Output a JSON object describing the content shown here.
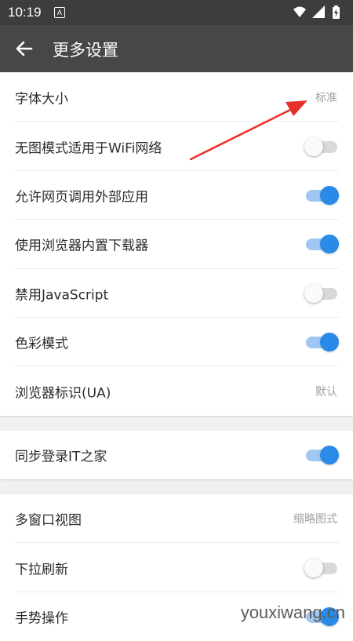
{
  "status_bar": {
    "time": "10:19",
    "notification_glyph": "A",
    "icons": [
      "wifi-icon",
      "signal-icon",
      "battery-icon"
    ]
  },
  "toolbar": {
    "title": "更多设置",
    "back_icon": "arrow-left-icon"
  },
  "colors": {
    "toolbar": "#474747",
    "status_bar": "#3d3d3d",
    "toggle_on": "#2a8ae8",
    "toggle_on_track": "#9ec8f2",
    "annotation_arrow": "#e8302a"
  },
  "groups": [
    {
      "rows": [
        {
          "label": "字体大小",
          "value": "标准"
        },
        {
          "label": "无图模式适用于WiFi网络",
          "toggle": false
        },
        {
          "label": "允许网页调用外部应用",
          "toggle": true
        },
        {
          "label": "使用浏览器内置下载器",
          "toggle": true
        },
        {
          "label": "禁用JavaScript",
          "toggle": false
        },
        {
          "label": "色彩模式",
          "toggle": true
        },
        {
          "label": "浏览器标识(UA)",
          "value": "默认"
        }
      ]
    },
    {
      "rows": [
        {
          "label": "同步登录IT之家",
          "toggle": true
        }
      ]
    },
    {
      "rows": [
        {
          "label": "多窗口视图",
          "value": "缩略图式"
        },
        {
          "label": "下拉刷新",
          "toggle": false
        },
        {
          "label": "手势操作",
          "toggle": true
        }
      ]
    }
  ],
  "watermark": "youxiwang.cn"
}
